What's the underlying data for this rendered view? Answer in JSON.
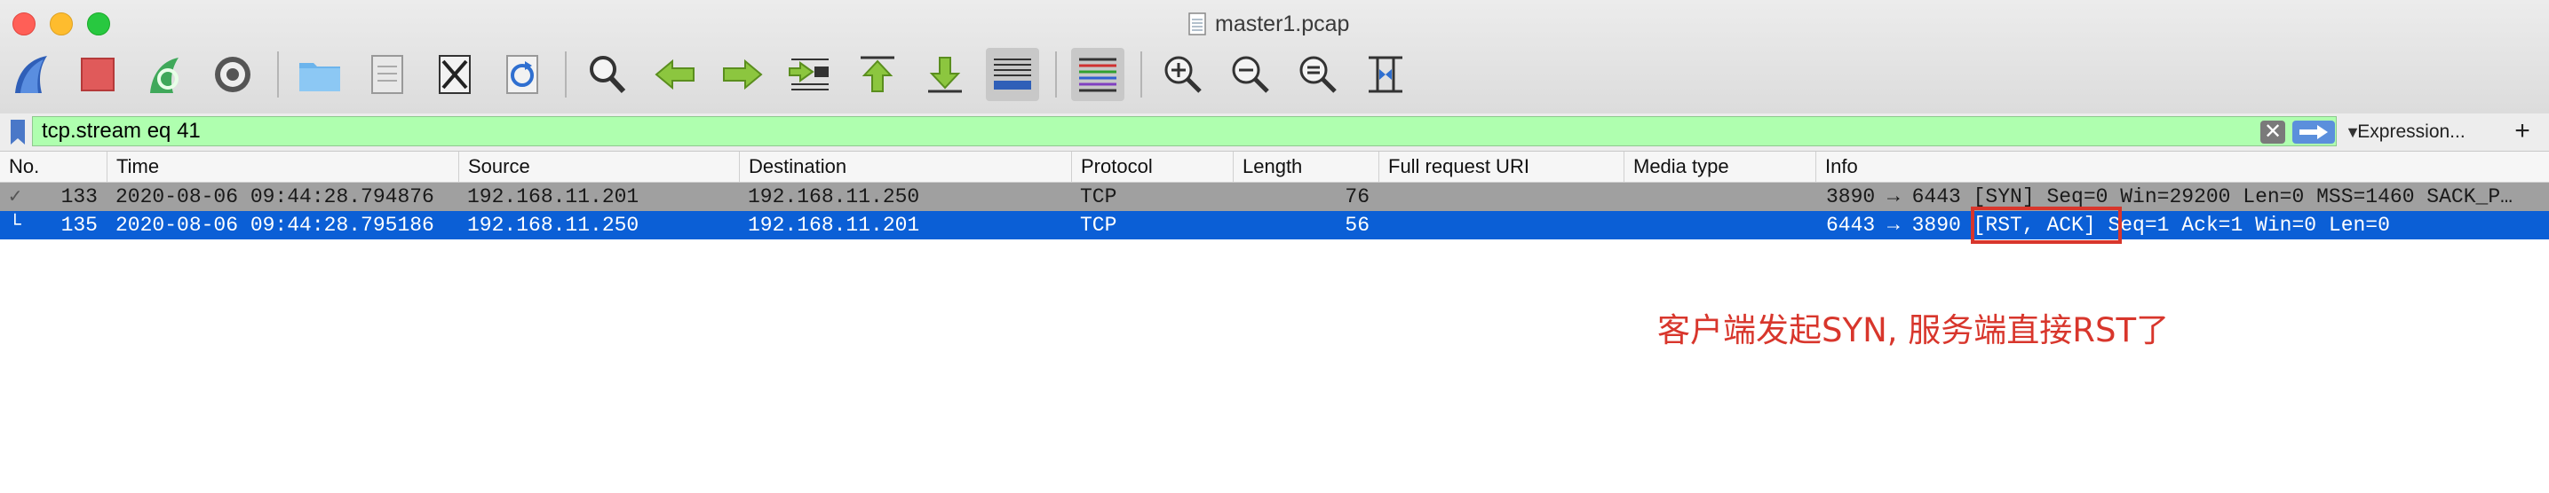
{
  "window": {
    "title": "master1.pcap"
  },
  "toolbar": {
    "buttons": [
      {
        "name": "start-capture-icon"
      },
      {
        "name": "stop-capture-icon"
      },
      {
        "name": "restart-capture-icon"
      },
      {
        "name": "capture-options-icon"
      },
      {
        "name": "open-file-icon"
      },
      {
        "name": "save-file-icon"
      },
      {
        "name": "close-file-icon"
      },
      {
        "name": "reload-file-icon"
      },
      {
        "name": "find-packet-icon"
      },
      {
        "name": "go-back-icon"
      },
      {
        "name": "go-forward-icon"
      },
      {
        "name": "go-to-packet-icon"
      },
      {
        "name": "go-first-packet-icon"
      },
      {
        "name": "go-last-packet-icon"
      },
      {
        "name": "auto-scroll-icon"
      },
      {
        "name": "colorize-icon"
      },
      {
        "name": "zoom-in-icon"
      },
      {
        "name": "zoom-out-icon"
      },
      {
        "name": "zoom-normal-icon"
      },
      {
        "name": "resize-columns-icon"
      }
    ]
  },
  "filter": {
    "value": "tcp.stream eq 41",
    "clear_icon": "✕",
    "dropdown_icon": "▼",
    "expression_label": "Expression...",
    "add_label": "+",
    "bg_color": "#afffaf"
  },
  "columns": [
    "No.",
    "Time",
    "Source",
    "Destination",
    "Protocol",
    "Length",
    "Full request URI",
    "Media type",
    "Info"
  ],
  "packets": [
    {
      "marker": "✓",
      "no": "133",
      "time": "2020-08-06 09:44:28.794876",
      "source": "192.168.11.201",
      "destination": "192.168.11.250",
      "protocol": "TCP",
      "length": "76",
      "uri": "",
      "media": "",
      "info": "3890 → 6443 [SYN] Seq=0 Win=29200 Len=0 MSS=1460 SACK_P…",
      "bg_color": "#a0a0a0"
    },
    {
      "marker": "└",
      "no": "135",
      "time": "2020-08-06 09:44:28.795186",
      "source": "192.168.11.250",
      "destination": "192.168.11.201",
      "protocol": "TCP",
      "length": "56",
      "uri": "",
      "media": "",
      "info": "6443 → 3890 [RST, ACK] Seq=1 Ack=1 Win=0 Len=0",
      "bg_color": "#0b5fd6",
      "selected": true
    }
  ],
  "annotation": {
    "text": "客户端发起SYN, 服务端直接RST了",
    "color": "#d8362c"
  }
}
